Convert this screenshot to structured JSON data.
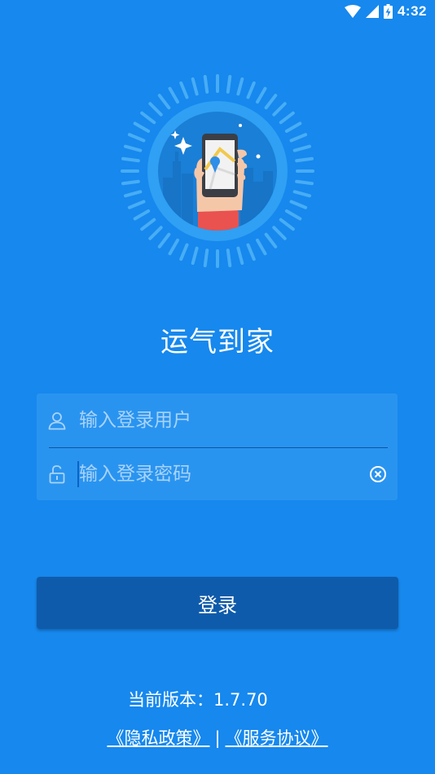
{
  "status_bar": {
    "time": "4:32",
    "icons": [
      "wifi-icon",
      "cellular-signal-icon",
      "battery-charging-icon"
    ]
  },
  "app": {
    "title": "运气到家",
    "logo_icon": "hand-holding-phone-map-logo"
  },
  "login_form": {
    "username_placeholder": "输入登录用户",
    "username_value": "",
    "password_placeholder": "输入登录密码",
    "password_value": ""
  },
  "login_button": {
    "label": "登录"
  },
  "footer": {
    "version_text": "当前版本：1.7.70",
    "privacy_link": "《隐私政策》",
    "separator": "|",
    "service_link": "《服务协议》"
  },
  "colors": {
    "background": "#1688ee",
    "form_card": "#2994f0",
    "login_button": "#0f5bab",
    "placeholder": "#a9d3f9"
  }
}
